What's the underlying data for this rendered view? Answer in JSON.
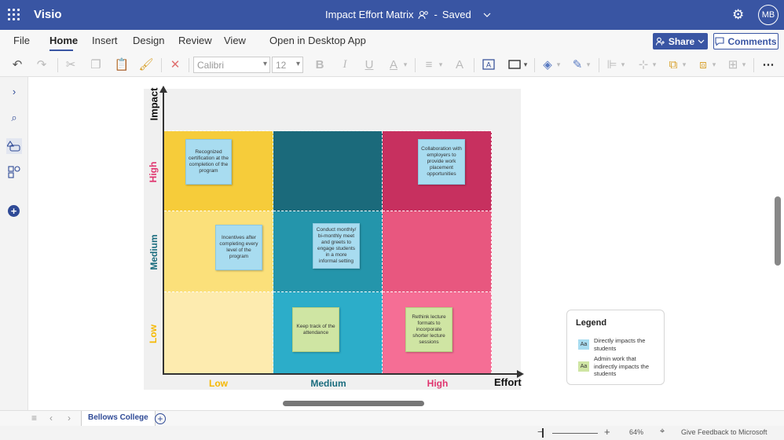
{
  "titlebar": {
    "app_name": "Visio",
    "document_title": "Impact Effort Matrix",
    "save_status": "Saved",
    "separator": "-",
    "avatar_initials": "MB",
    "color": "#3955a3"
  },
  "menu": {
    "items": [
      "File",
      "Home",
      "Insert",
      "Design",
      "Review",
      "View",
      "Open in Desktop App"
    ],
    "active": "Home",
    "share_label": "Share",
    "comments_label": "Comments"
  },
  "toolbar": {
    "font_name": "Calibri",
    "font_size": "12",
    "bold": "B",
    "italic": "I",
    "underline": "U",
    "font_color_glyph": "A",
    "more_glyph": "⋯"
  },
  "matrix": {
    "axis_title_y": "Impact",
    "axis_title_x": "Effort",
    "y_levels": [
      "High",
      "Medium",
      "Low"
    ],
    "x_levels": [
      "Low",
      "Medium",
      "High"
    ],
    "level_colors": {
      "low": "#f5b800",
      "medium": "#1a6c7e",
      "high": "#e0356f"
    },
    "cell_colors": [
      [
        "#f6cc3a",
        "#1b6a7b",
        "#c7305f"
      ],
      [
        "#fbe07a",
        "#2495ab",
        "#e8577f"
      ],
      [
        "#fdebaf",
        "#2cadc9",
        "#f56e95"
      ]
    ],
    "notes": [
      {
        "text": "Recognized certification at the completion of the program",
        "type": "blue"
      },
      {
        "text": "Collaboration with employers to provide work placement opportunities",
        "type": "blue"
      },
      {
        "text": "Incentives after completing every level of the program",
        "type": "blue"
      },
      {
        "text": "Conduct monthly/ bi-monthly meet and greets to engage students in a more informal setting",
        "type": "blue"
      },
      {
        "text": "Keep track of the attendance",
        "type": "green"
      },
      {
        "text": "Rethink lecture formats to incorporate shorter lecture sessions",
        "type": "green"
      }
    ]
  },
  "legend": {
    "title": "Legend",
    "items": [
      {
        "swatch": "Aa",
        "label": "Directly impacts the students",
        "color": "#a8dcf0"
      },
      {
        "swatch": "Aa",
        "label": "Admin work that indirectly impacts the students",
        "color": "#cfe5a3"
      }
    ]
  },
  "pagebar": {
    "page_tab": "Bellows College",
    "add_glyph": "+"
  },
  "statusbar": {
    "zoom_minus": "−",
    "zoom_plus": "+",
    "zoom_level": "64%",
    "feedback": "Give Feedback to Microsoft"
  }
}
